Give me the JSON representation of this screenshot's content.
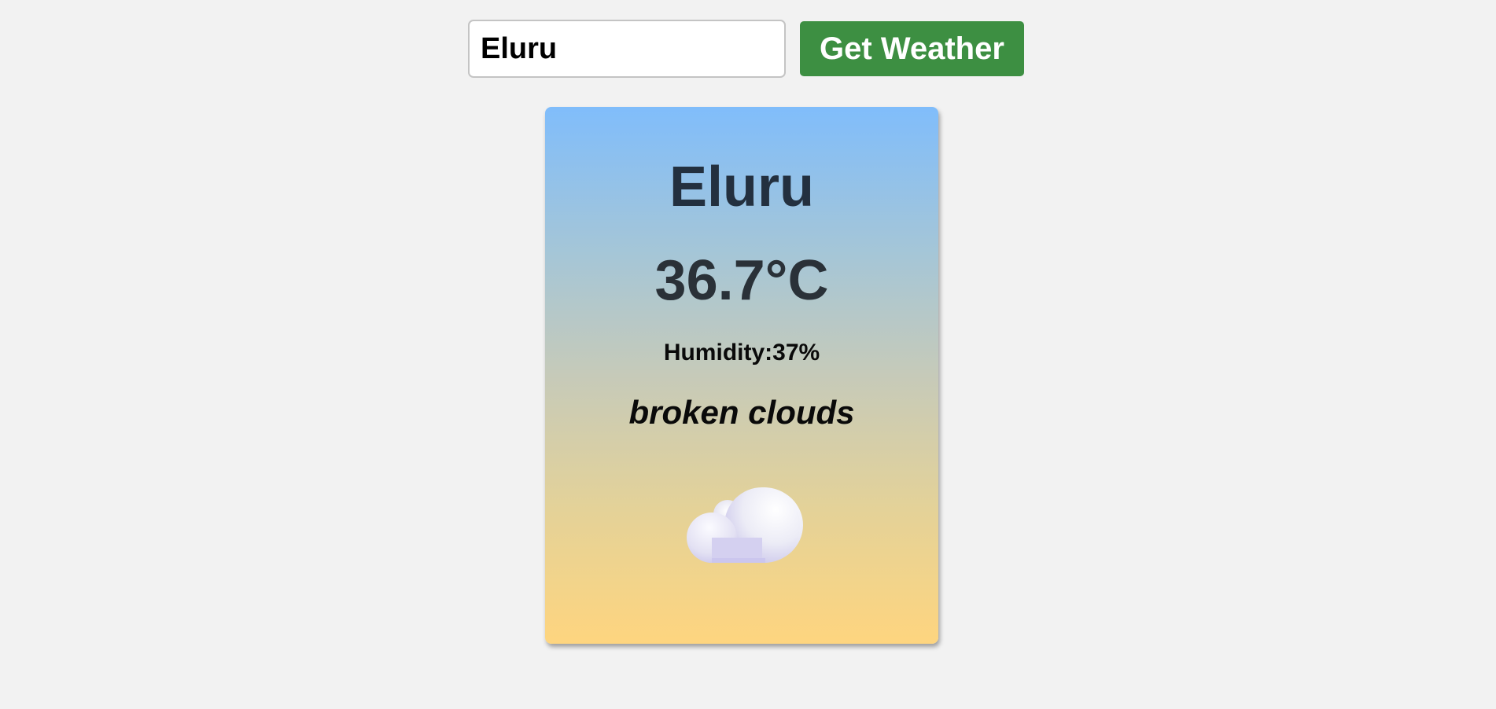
{
  "search": {
    "value": "Eluru",
    "button_label": "Get Weather"
  },
  "weather": {
    "city": "Eluru",
    "temperature": "36.7°C",
    "humidity": "Humidity:37%",
    "description": "broken clouds",
    "icon": "broken-clouds-icon"
  },
  "colors": {
    "button": "#3d8f42",
    "card_top": "#80bdfb",
    "card_bottom": "#fed57f",
    "page_background": "#f2f2f2"
  }
}
